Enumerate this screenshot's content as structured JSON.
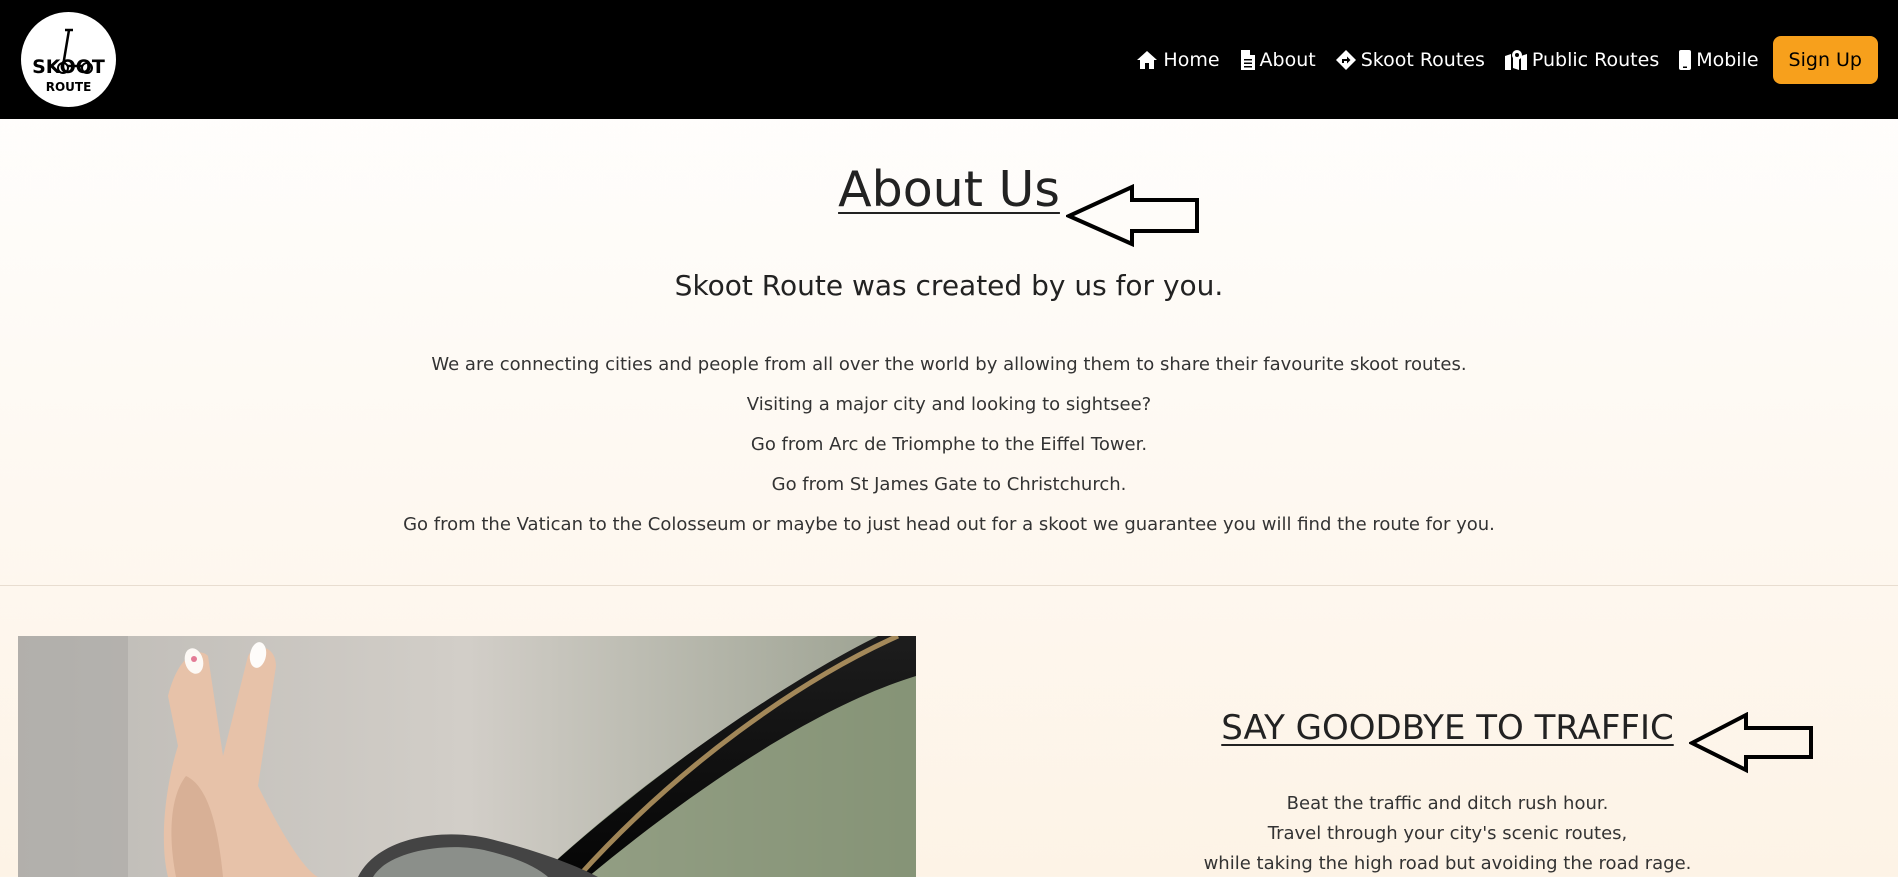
{
  "brand": {
    "logo_title": "SKOOT",
    "logo_sub": "ROUTE"
  },
  "nav": {
    "items": [
      {
        "label": "Home",
        "icon": "home-icon"
      },
      {
        "label": "About",
        "icon": "file-icon"
      },
      {
        "label": "Skoot Routes",
        "icon": "directions-icon"
      },
      {
        "label": "Public Routes",
        "icon": "map-marker-icon"
      },
      {
        "label": "Mobile",
        "icon": "mobile-icon"
      }
    ],
    "signup_label": "Sign Up"
  },
  "about": {
    "title": "About Us",
    "subtitle": "Skoot Route was created by us for you.",
    "lines": [
      "We are connecting cities and people from all over the world by allowing them to share their favourite skoot routes.",
      "Visiting a major city and looking to sightsee?",
      "Go from Arc de Triomphe to the Eiffel Tower.",
      "Go from St James Gate to Christchurch.",
      "Go from the Vatican to the Colosseum or maybe to just head out for a skoot we guarantee you will find the route for you."
    ]
  },
  "traffic": {
    "title": "SAY GOODBYE TO TRAFFIC",
    "lines": [
      "Beat the traffic and ditch rush hour.",
      "Travel through your city's scenic routes,",
      "while taking the high road but avoiding the road rage."
    ]
  },
  "colors": {
    "navbar_bg": "#000000",
    "accent": "#f7a01c",
    "text": "#222222"
  }
}
